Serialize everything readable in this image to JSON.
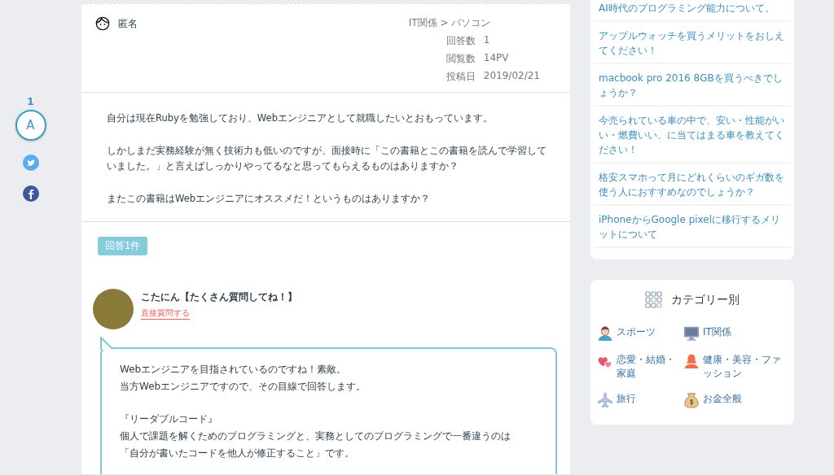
{
  "share": {
    "count": "1",
    "letter": "A"
  },
  "question": {
    "author": "匿名",
    "category": "IT関係 > パソコン",
    "meta": [
      {
        "label": "回答数",
        "value": "1"
      },
      {
        "label": "閲覧数",
        "value": "14PV"
      },
      {
        "label": "投稿日",
        "value": "2019/02/21"
      }
    ],
    "paragraphs": [
      "自分は現在Rubyを勉強しており、Webエンジニアとして就職したいとおもっています。",
      "しかしまだ実務経験が無く技術力も低いのですが、面接時に「この書籍とこの書籍を読んで学習していました。」と言えばしっかりやってるなと思ってもらえるものはありますか？",
      "またこの書籍はWebエンジニアにオススメだ！というものはありますか？"
    ]
  },
  "answers": {
    "badge": "回答1件",
    "items": [
      {
        "name": "こたにん【たくさん質問してね！】",
        "link": "直接質問する",
        "paragraphs": [
          [
            "Webエンジニアを目指されているのですね！素敵。",
            "当方Webエンジニアですので、その目線で回答します。"
          ],
          [
            "『リーダブルコード』",
            "個人で課題を解くためのプログラミングと、実務としてのプログラミングで一番違うのは",
            "「自分が書いたコードを他人が修正すること」です。"
          ]
        ]
      }
    ]
  },
  "sidebar": {
    "related": [
      "AI時代のプログラミング能力について。",
      "アップルウォッチを買うメリットをおしえてください！",
      "macbook pro 2016 8GBを買うべきでしょうか？",
      "今売られている車の中で、安い・性能がいい・燃費いい、に当てはまる車を教えてください！",
      "格安スマホって月にどれくらいのギガ数を使う人におすすめなのでしょうか？",
      "iPhoneからGoogle pixelに移行するメリットについて"
    ],
    "categories": {
      "title": "カテゴリー別",
      "items": [
        {
          "label": "スポーツ",
          "kind": "person"
        },
        {
          "label": "IT関係",
          "kind": "monitor"
        },
        {
          "label": "恋愛・結婚・家庭",
          "kind": "hearts"
        },
        {
          "label": "健康・美容・ファッション",
          "kind": "woman"
        },
        {
          "label": "旅行",
          "kind": "plane"
        },
        {
          "label": "お金全般",
          "kind": "money"
        }
      ]
    }
  }
}
